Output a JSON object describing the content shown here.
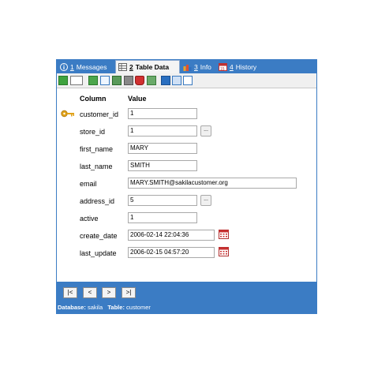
{
  "tabs": [
    {
      "num": "1",
      "label": "Messages"
    },
    {
      "num": "2",
      "label": "Table Data"
    },
    {
      "num": "3",
      "label": "Info"
    },
    {
      "num": "4",
      "label": "History"
    }
  ],
  "columns": {
    "column": "Column",
    "value": "Value"
  },
  "rows": [
    {
      "name": "customer_id",
      "value": "1"
    },
    {
      "name": "store_id",
      "value": "1"
    },
    {
      "name": "first_name",
      "value": "MARY"
    },
    {
      "name": "last_name",
      "value": "SMITH"
    },
    {
      "name": "email",
      "value": "MARY.SMITH@sakilacustomer.org"
    },
    {
      "name": "address_id",
      "value": "5"
    },
    {
      "name": "active",
      "value": "1"
    },
    {
      "name": "create_date",
      "value": "2006-02-14 22:04:36"
    },
    {
      "name": "last_update",
      "value": "2006-02-15 04:57:20"
    }
  ],
  "lookup_label": "...",
  "nav": {
    "first": "|<",
    "prev": "<",
    "next": ">",
    "last": ">|"
  },
  "status": {
    "db_label": "Database:",
    "db_value": "sakila",
    "table_label": "Table:",
    "table_value": "customer"
  },
  "colors": {
    "frame": "#3b7cc4",
    "key": "#e0a21a"
  },
  "icons": [
    "info-icon",
    "table-icon",
    "info-chart-icon",
    "calendar-icon",
    "key-icon"
  ]
}
